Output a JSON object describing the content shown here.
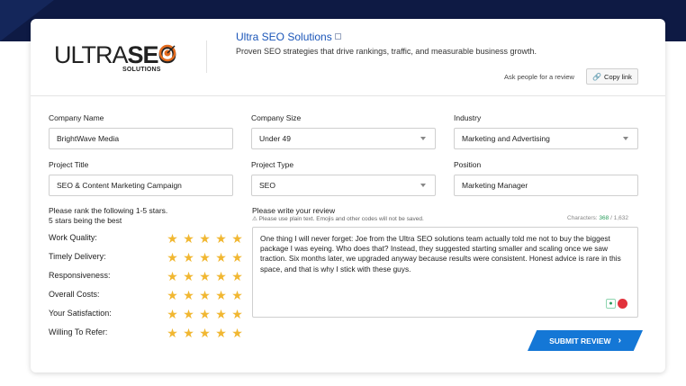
{
  "brand": {
    "logo_main_thin": "ULTRA",
    "logo_main_bold": "SEO",
    "logo_sub": "SOLUTIONS",
    "title": "Ultra SEO Solutions",
    "tagline": "Proven SEO strategies that drive rankings, traffic, and measurable business growth."
  },
  "share": {
    "ask_text": "Ask people for a review",
    "copy_label": "Copy link"
  },
  "form": {
    "company_name": {
      "label": "Company Name",
      "value": "BrightWave Media"
    },
    "company_size": {
      "label": "Company Size",
      "value": "Under 49"
    },
    "industry": {
      "label": "Industry",
      "value": "Marketing and Advertising"
    },
    "project_title": {
      "label": "Project Title",
      "value": "SEO & Content Marketing Campaign"
    },
    "project_type": {
      "label": "Project Type",
      "value": "SEO"
    },
    "position": {
      "label": "Position",
      "value": "Marketing Manager"
    }
  },
  "ratings": {
    "heading_line1": "Please rank the following 1-5 stars.",
    "heading_line2": "5 stars being the best",
    "star_glyph": "★",
    "star_color": "#f1b731",
    "items": [
      {
        "label": "Work Quality:",
        "stars": 5
      },
      {
        "label": "Timely Delivery:",
        "stars": 5
      },
      {
        "label": "Responsiveness:",
        "stars": 5
      },
      {
        "label": "Overall Costs:",
        "stars": 5
      },
      {
        "label": "Your Satisfaction:",
        "stars": 5
      },
      {
        "label": "Willing To Refer:",
        "stars": 5
      }
    ]
  },
  "review": {
    "label": "Please write your review",
    "warning": "⚠ Please use plain text. Emojis and other codes will not be saved.",
    "chars_label": "Characters:",
    "chars_count": "368",
    "chars_max": "/ 1,632",
    "text": "One thing I will never forget: Joe from the Ultra SEO solutions team actually told me not to buy the biggest package I was eyeing. Who does that? Instead, they suggested starting smaller and scaling once we saw traction. Six months later, we upgraded anyway because results were consistent. Honest advice is rare in this space, and that is why I stick with these guys."
  },
  "submit": {
    "label": "SUBMIT REVIEW",
    "chevron": "›"
  },
  "colors": {
    "accent": "#1477d6",
    "navy": "#0e1a44",
    "link": "#1a55b8"
  }
}
